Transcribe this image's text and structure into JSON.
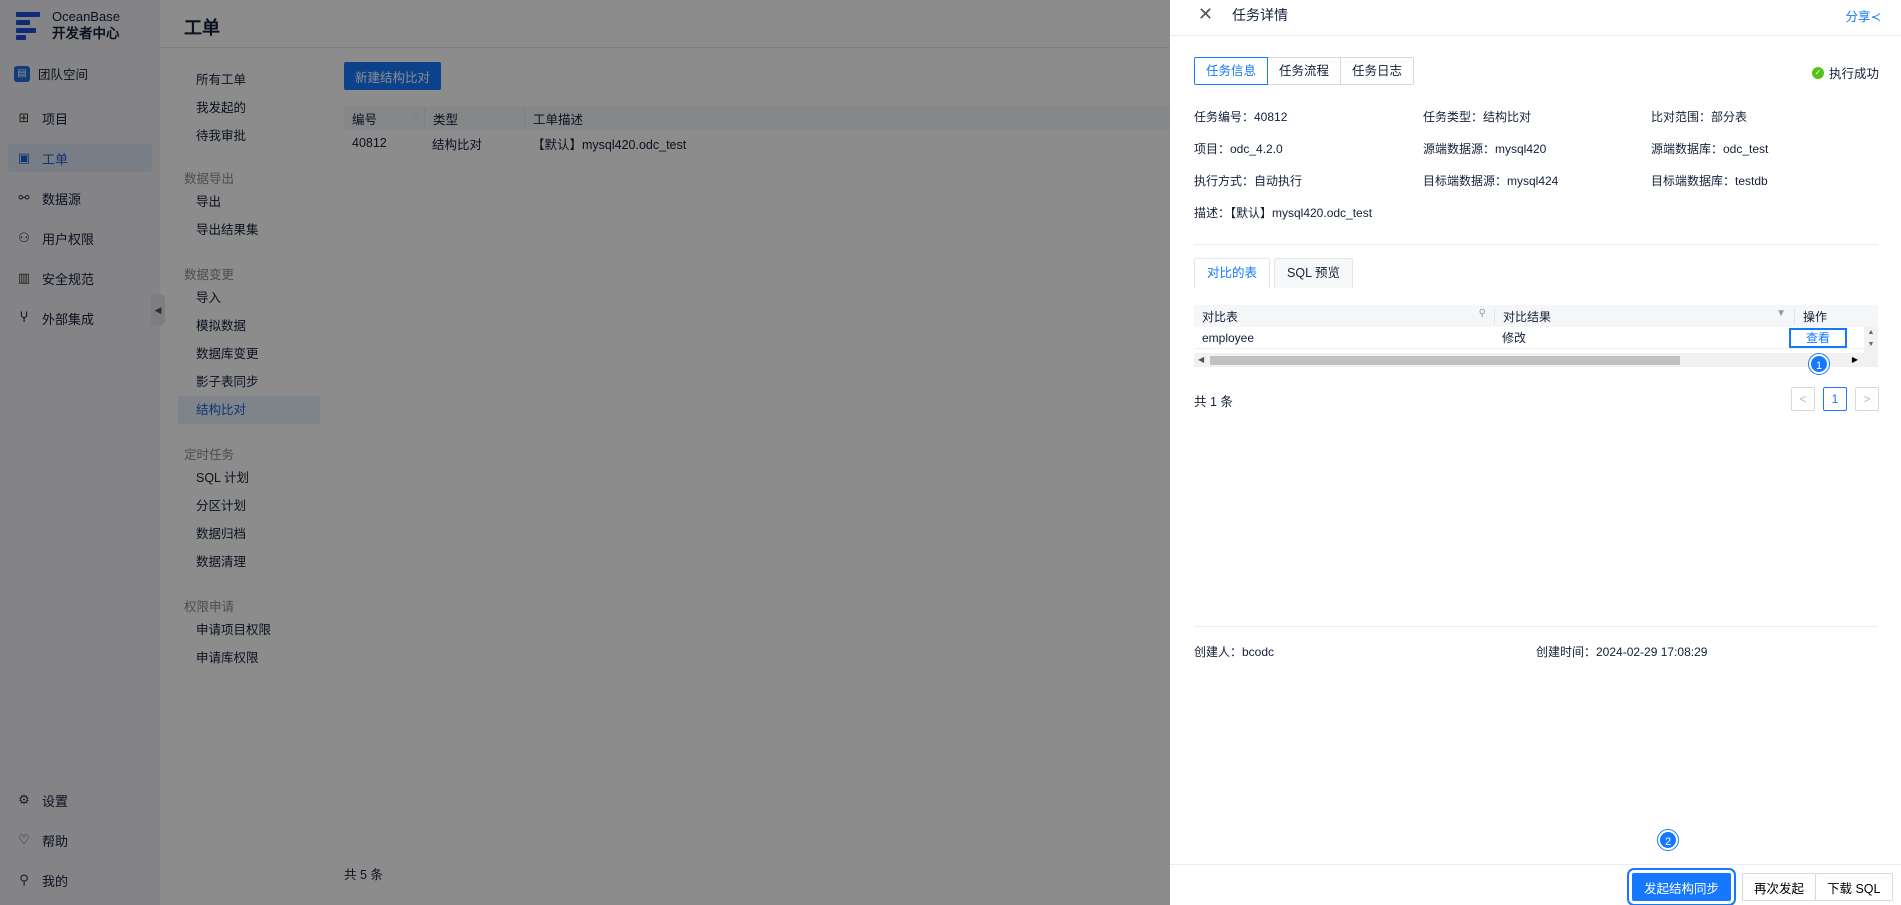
{
  "nav": {
    "logo_line1": "OceanBase",
    "logo_line2": "开发者中心",
    "team": "团队空间",
    "items": [
      {
        "label": "项目",
        "icon": "grid-icon"
      },
      {
        "label": "工单",
        "icon": "briefcase-icon"
      },
      {
        "label": "数据源",
        "icon": "link-icon"
      },
      {
        "label": "用户权限",
        "icon": "users-icon"
      },
      {
        "label": "安全规范",
        "icon": "audit-icon"
      },
      {
        "label": "外部集成",
        "icon": "fork-icon"
      }
    ],
    "bottom": [
      {
        "label": "设置",
        "icon": "gear-icon"
      },
      {
        "label": "帮助",
        "icon": "bulb-icon"
      },
      {
        "label": "我的",
        "icon": "user-icon"
      }
    ]
  },
  "header": {
    "title": "工单"
  },
  "subnav": {
    "top": [
      "所有工单",
      "我发起的",
      "待我审批"
    ],
    "groups": [
      {
        "label": "数据导出",
        "items": [
          "导出",
          "导出结果集"
        ]
      },
      {
        "label": "数据变更",
        "items": [
          "导入",
          "模拟数据",
          "数据库变更",
          "影子表同步",
          "结构比对"
        ]
      },
      {
        "label": "定时任务",
        "items": [
          "SQL 计划",
          "分区计划",
          "数据归档",
          "数据清理"
        ]
      },
      {
        "label": "权限申请",
        "items": [
          "申请项目权限",
          "申请库权限"
        ]
      }
    ],
    "active": "结构比对"
  },
  "main": {
    "new_button": "新建结构比对",
    "columns": [
      "编号",
      "类型",
      "工单描述"
    ],
    "rows": [
      {
        "id": "40812",
        "type": "结构比对",
        "desc": "【默认】mysql420.odc_test"
      }
    ],
    "total": "共 5 条"
  },
  "drawer": {
    "title": "任务详情",
    "share": "分享",
    "tabs": [
      "任务信息",
      "任务流程",
      "任务日志"
    ],
    "status": "执行成功",
    "info": {
      "task_id": "任务编号：40812",
      "task_type": "任务类型：结构比对",
      "scope": "比对范围：部分表",
      "project": "项目：odc_4.2.0",
      "src_ds": "源端数据源：mysql420",
      "src_db": "源端数据库：odc_test",
      "exec": "执行方式：自动执行",
      "tgt_ds": "目标端数据源：mysql424",
      "tgt_db": "目标端数据库：testdb",
      "desc": "描述：【默认】mysql420.odc_test"
    },
    "sub_tabs": [
      "对比的表",
      "SQL 预览"
    ],
    "cmp_columns": [
      "对比表",
      "对比结果",
      "操作"
    ],
    "cmp_rows": [
      {
        "table": "employee",
        "result": "修改",
        "action": "查看"
      }
    ],
    "total": "共 1 条",
    "page": "1",
    "creator": "创建人：bcodc",
    "created_at": "创建时间：2024-02-29 17:08:29",
    "buttons": {
      "sync": "发起结构同步",
      "retry": "再次发起",
      "download": "下载 SQL"
    },
    "badges": [
      "1",
      "2"
    ]
  }
}
